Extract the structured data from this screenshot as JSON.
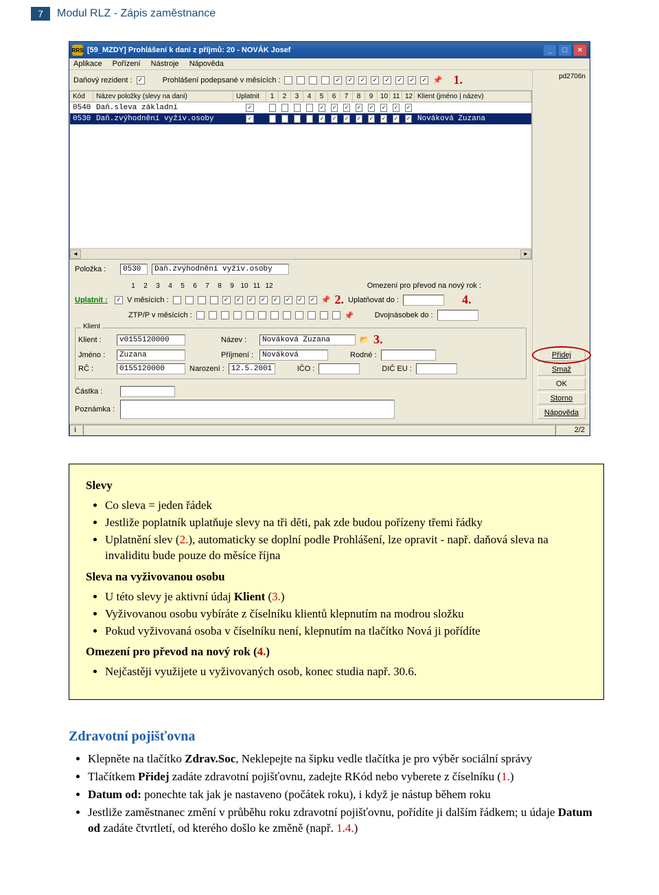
{
  "header": {
    "page_num": "7",
    "doc_title": "Modul RLZ - Zápis zaměstnance"
  },
  "annotations": {
    "n1": "1.",
    "n2": "2.",
    "n3": "3.",
    "n4": "4."
  },
  "window": {
    "title": "[59_MZDY] Prohlášení k dani z příjmů: 20 - NOVÁK Josef",
    "pdcode": "pd2706n",
    "menu": {
      "m1": "Aplikace",
      "m2": "Pořízení",
      "m3": "Nástroje",
      "m4": "Nápověda"
    },
    "toolbar": {
      "rezident": "Daňový rezident :",
      "prohl": "Prohlášení podepsané v měsících :"
    },
    "grid_header": {
      "kod": "Kód",
      "nazev": "Název položky (slevy na dani)",
      "upl": "Uplatnit",
      "m1": "1",
      "m2": "2",
      "m3": "3",
      "m4": "4",
      "m5": "5",
      "m6": "6",
      "m7": "7",
      "m8": "8",
      "m9": "9",
      "m10": "10",
      "m11": "11",
      "m12": "12",
      "klient": "Klient (jméno | název)"
    },
    "rows": [
      {
        "kod": "0540",
        "nazev": "Daň.sleva základní",
        "klient": ""
      },
      {
        "kod": "0530",
        "nazev": "Daň.zvýhodnění vyživ.osoby",
        "klient": "Nováková Zuzana"
      }
    ],
    "polozka": {
      "label": "Položka :",
      "code": "0530",
      "name": "Daň.zvýhodnění vyživ.osoby"
    },
    "uplatnit": {
      "label": "Uplatnit :",
      "vmes": "V měsících :",
      "ztp": "ZTP/P v měsících :"
    },
    "months": {
      "m1": "1",
      "m2": "2",
      "m3": "3",
      "m4": "4",
      "m5": "5",
      "m6": "6",
      "m7": "7",
      "m8": "8",
      "m9": "9",
      "m10": "10",
      "m11": "11",
      "m12": "12"
    },
    "omezeni": {
      "title": "Omezení pro převod na nový rok :",
      "do": "Uplatňovat do :",
      "dvoj": "Dvojnásobek do :"
    },
    "klient": {
      "box": "Klient",
      "klient_l": "Klient :",
      "klient_v": "v0155120000",
      "nazev_l": "Název :",
      "nazev_v": "Nováková Zuzana",
      "jmeno_l": "Jméno :",
      "jmeno_v": "Zuzana",
      "prijm_l": "Příjmení :",
      "prijm_v": "Nováková",
      "rodne_l": "Rodné :",
      "rc_l": "RČ :",
      "rc_v": "0155120000",
      "naroz_l": "Narození :",
      "naroz_v": "12.5.2001",
      "ico_l": "IČO :",
      "dic_l": "DIČ EU :"
    },
    "castka": "Částka :",
    "pozn": "Poznámka :",
    "buttons": {
      "pridej": "Přidej",
      "smaz": "Smaž",
      "ok": "OK",
      "storno": "Storno",
      "napoveda": "Nápověda"
    },
    "status": {
      "info": "i",
      "count": "2/2"
    }
  },
  "box1": {
    "h_slevy": "Slevy",
    "b1": "Co sleva = jeden řádek",
    "b2": "Jestliže poplatník uplatňuje slevy na tři děti, pak zde budou pořízeny třemi řádky",
    "b3a": "Uplatnění slev (",
    "b3b": "2.",
    "b3c": "), automaticky se doplní podle Prohlášení, lze opravit - např. daňová sleva na invaliditu bude pouze do měsíce října",
    "h_sleva_vyz": "Sleva na vyživovanou osobu",
    "b4a": "U této slevy je aktivní údaj ",
    "b4b": "Klient",
    "b4c": " (",
    "b4d": "3.",
    "b4e": ")",
    "b5": "Vyživovanou osobu vybíráte z číselníku klientů klepnutím na modrou složku",
    "b6": "Pokud vyživovaná osoba v číselníku není, klepnutím na tlačítko Nová ji pořídíte",
    "h_omez_a": "Omezení pro převod na nový rok (",
    "h_omez_b": "4.",
    "h_omez_c": ")",
    "b7": "Nejčastěji využijete u vyživovaných osob, konec studia např. 30.6."
  },
  "sec2": {
    "heading": "Zdravotní pojišťovna",
    "b1a": "Klepněte na tlačítko ",
    "b1b": "Zdrav.Soc",
    "b1c": ", Neklepejte na šipku vedle tlačítka je pro výběr sociální správy",
    "b2a": "Tlačítkem ",
    "b2b": "Přidej",
    "b2c": " zadáte zdravotní pojišťovnu, zadejte RKód nebo vyberete z číselníku (",
    "b2d": "1.",
    "b2e": ")",
    "b3a": "Datum od:",
    "b3b": " ponechte tak jak je nastaveno (počátek roku), i když je nástup během roku",
    "b4a": "Jestliže zaměstnanec změní v průběhu roku zdravotní pojišťovnu, pořídíte ji dalším řádkem; u údaje ",
    "b4b": "Datum od",
    "b4c": " zadáte čtvrtletí, od kterého došlo ke změně (např. ",
    "b4d": "1.4.",
    "b4e": ")"
  }
}
